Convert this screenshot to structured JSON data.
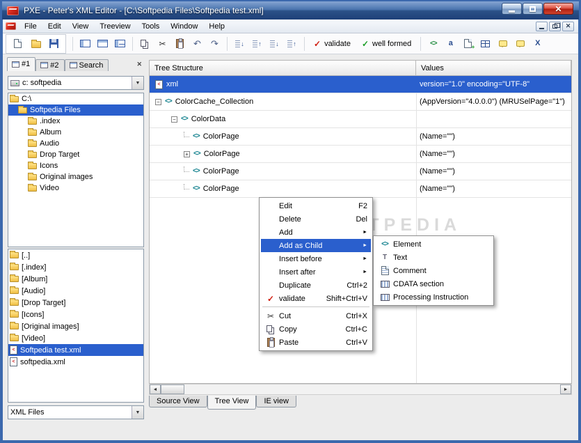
{
  "window": {
    "title": "PXE - Peter's XML Editor - [C:\\Softpedia Files\\Softpedia test.xml]"
  },
  "menu": {
    "items": [
      "File",
      "Edit",
      "View",
      "Treeview",
      "Tools",
      "Window",
      "Help"
    ]
  },
  "toolbar": {
    "validate_label": "validate",
    "well_formed_label": "well formed"
  },
  "left_panel": {
    "tabs": [
      "#1",
      "#2",
      "Search"
    ],
    "drive_combo_value": "c: softpedia",
    "folder_tree": [
      "C:\\",
      "Softpedia Files",
      ".index",
      "Album",
      "Audio",
      "Drop Target",
      "Icons",
      "Original images",
      "Video"
    ],
    "file_list": [
      "[..]",
      "[.index]",
      "[Album]",
      "[Audio]",
      "[Drop Target]",
      "[Icons]",
      "[Original images]",
      "[Video]",
      "Softpedia test.xml",
      "softpedia.xml"
    ],
    "filter_combo_value": "XML Files"
  },
  "grid": {
    "columns": [
      "Tree Structure",
      "Values"
    ],
    "rows": [
      {
        "label": "xml",
        "value": "version=\"1.0\" encoding=\"UTF-8\""
      },
      {
        "label": "ColorCache_Collection",
        "value": "(AppVersion=\"4.0.0.0\") (MRUSelPage=\"1\")"
      },
      {
        "label": "ColorData",
        "value": ""
      },
      {
        "label": "ColorPage",
        "value": "(Name=\"\")"
      },
      {
        "label": "ColorPage",
        "value": "(Name=\"\")"
      },
      {
        "label": "ColorPage",
        "value": "(Name=\"\")"
      },
      {
        "label": "ColorPage",
        "value": "(Name=\"\")"
      }
    ]
  },
  "context_menu": {
    "items": [
      {
        "label": "Edit",
        "shortcut": "F2"
      },
      {
        "label": "Delete",
        "shortcut": "Del"
      },
      {
        "label": "Add"
      },
      {
        "label": "Add as Child"
      },
      {
        "label": "Insert before"
      },
      {
        "label": "Insert after"
      },
      {
        "label": "Duplicate",
        "shortcut": "Ctrl+2"
      },
      {
        "label": "validate",
        "shortcut": "Shift+Ctrl+V"
      },
      {
        "label": "Cut",
        "shortcut": "Ctrl+X"
      },
      {
        "label": "Copy",
        "shortcut": "Ctrl+C"
      },
      {
        "label": "Paste",
        "shortcut": "Ctrl+V"
      }
    ]
  },
  "submenu": {
    "items": [
      "Element",
      "Text",
      "Comment",
      "CDATA section",
      "Processing Instruction"
    ]
  },
  "bottom_tabs": [
    "Source View",
    "Tree View",
    "IE view"
  ],
  "watermark": "SOFTPEDIA",
  "icons": {
    "close": "✕",
    "dropdown": "▼",
    "submenu_arrow": "►",
    "scroll_left": "◄",
    "scroll_right": "►",
    "check": "✓",
    "scissors": "✂",
    "undo": "↶",
    "redo": "↷",
    "arrow_down": "↓",
    "arrow_up": "↑",
    "element_brackets": "<>",
    "letter_a": "a",
    "letter_x": "X",
    "letter_t": "T",
    "minus": "−",
    "plus": "+"
  },
  "colors": {
    "selection": "#2a5fcd",
    "titlebar": "#2c5188",
    "close_button": "#b02012",
    "validate_check": "#cf1d10",
    "wellformed_check": "#1d9e28"
  }
}
